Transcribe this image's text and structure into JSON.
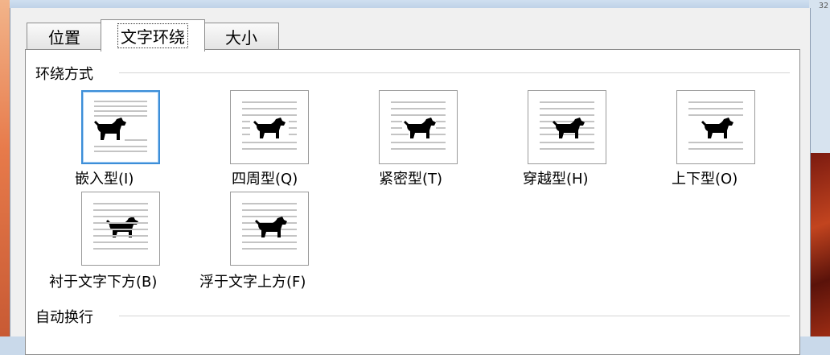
{
  "background": {
    "ruler_number": "32"
  },
  "tabs": [
    {
      "label": "位置"
    },
    {
      "label": "文字环绕"
    },
    {
      "label": "大小"
    }
  ],
  "wrap_section": {
    "title": "环绕方式"
  },
  "options": [
    {
      "label": "嵌入型(I)",
      "icon": "inline-wrap-icon"
    },
    {
      "label": "四周型(Q)",
      "icon": "square-wrap-icon"
    },
    {
      "label": "紧密型(T)",
      "icon": "tight-wrap-icon"
    },
    {
      "label": "穿越型(H)",
      "icon": "through-wrap-icon"
    },
    {
      "label": "上下型(O)",
      "icon": "top-bottom-wrap-icon"
    },
    {
      "label": "衬于文字下方(B)",
      "icon": "behind-text-icon"
    },
    {
      "label": "浮于文字上方(F)",
      "icon": "in-front-text-icon"
    }
  ],
  "autowrap_section": {
    "title": "自动换行"
  },
  "colors": {
    "accent": "#3c8ed8",
    "text_line": "#bdbdbd",
    "dog": "#000000"
  }
}
